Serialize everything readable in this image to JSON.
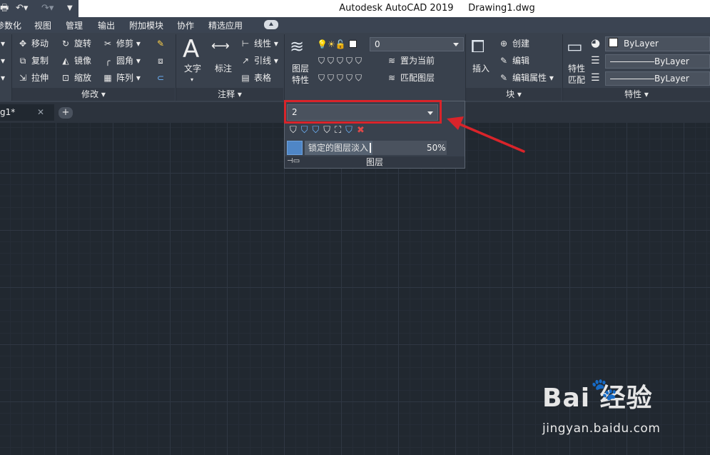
{
  "titlebar": {
    "app_title": "Autodesk AutoCAD 2019",
    "file_name": "Drawing1.dwg"
  },
  "menu": {
    "tabs": [
      "参数化",
      "视图",
      "管理",
      "输出",
      "附加模块",
      "协作",
      "精选应用"
    ]
  },
  "ribbon": {
    "modify": {
      "items": [
        "移动",
        "旋转",
        "修剪",
        "复制",
        "镜像",
        "圆角",
        "拉伸",
        "缩放",
        "阵列"
      ],
      "footer": "修改"
    },
    "annotation": {
      "text_label": "文字",
      "dimension_label": "标注",
      "linear_label": "线性",
      "leader_label": "引线",
      "table_label": "表格",
      "footer": "注释"
    },
    "layers": {
      "layer_props_label": "图层\n特性",
      "current_layer": "0",
      "set_current_label": "置为当前",
      "match_layer_label": "匹配图层",
      "footer": "图层"
    },
    "block": {
      "insert_label": "插入",
      "create_label": "创建",
      "edit_label": "编辑",
      "edit_attr_label": "编辑属性",
      "footer": "块"
    },
    "properties": {
      "match_label": "特性\n匹配",
      "color": "ByLayer",
      "linetype": "ByLayer",
      "lineweight": "ByLayer",
      "footer": "特性"
    }
  },
  "doc_tab": {
    "label": "g1*"
  },
  "layer_dropdown": {
    "selected_layer": "2",
    "locked_fade_label": "锁定的图层淡入",
    "fade_percent": "50%",
    "footer": "图层"
  },
  "watermark": {
    "brand": "Bai  经验",
    "url": "jingyan.baidu.com"
  },
  "colors": {
    "highlight": "#d9242a",
    "ribbon_bg": "#39414d",
    "canvas_bg": "#212830"
  }
}
